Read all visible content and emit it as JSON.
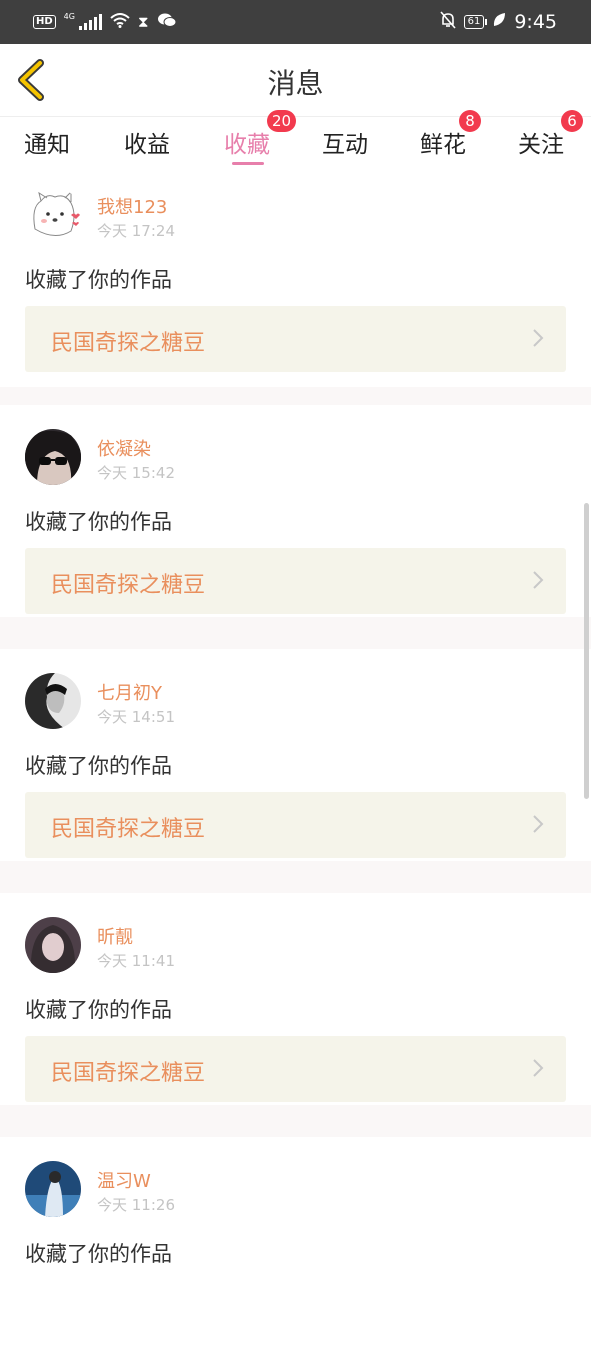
{
  "status_bar": {
    "hd": "HD",
    "network": "4G",
    "time": "9:45",
    "battery": "61",
    "icons": [
      "signal-icon",
      "wifi-icon",
      "hourglass-icon",
      "wechat-icon",
      "bell-off-icon",
      "battery-icon",
      "leaf-icon"
    ]
  },
  "header": {
    "title": "消息",
    "back_icon": "back-chevron-icon",
    "accent": "#f5c400"
  },
  "tabs": [
    {
      "label": "通知",
      "badge": ""
    },
    {
      "label": "收益",
      "badge": ""
    },
    {
      "label": "收藏",
      "badge": "20",
      "active": true
    },
    {
      "label": "互动",
      "badge": ""
    },
    {
      "label": "鲜花",
      "badge": "8"
    },
    {
      "label": "关注",
      "badge": "6"
    }
  ],
  "colors": {
    "tab_active": "#e77fab",
    "username": "#e98f5d",
    "badge": "#f23a4e"
  },
  "messages": [
    {
      "user": "我想123",
      "time": "今天 17:24",
      "action": "收藏了你的作品",
      "work": "民国奇探之糖豆"
    },
    {
      "user": "依凝染",
      "time": "今天 15:42",
      "action": "收藏了你的作品",
      "work": "民国奇探之糖豆"
    },
    {
      "user": "七月初Y",
      "time": "今天 14:51",
      "action": "收藏了你的作品",
      "work": "民国奇探之糖豆"
    },
    {
      "user": "昕靓",
      "time": "今天 11:41",
      "action": "收藏了你的作品",
      "work": "民国奇探之糖豆"
    },
    {
      "user": "温习W",
      "time": "今天 11:26",
      "action": "收藏了你的作品",
      "work": ""
    }
  ]
}
